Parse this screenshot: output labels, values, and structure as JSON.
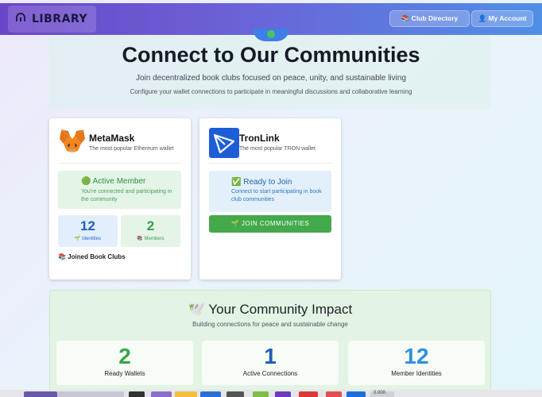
{
  "topbar": {
    "brand": "LIBRARY",
    "nav": [
      {
        "label": "📚 Club Directory"
      },
      {
        "label": "👤 My Account"
      }
    ]
  },
  "hero": {
    "title": "Connect to Our Communities",
    "subtitle": "Join decentralized book clubs focused on peace, unity, and sustainable living",
    "description": "Configure your wallet connections to participate in meaningful discussions and collaborative learning"
  },
  "wallets": {
    "metamask": {
      "name": "MetaMask",
      "desc": "The most popular Ethereum wallet",
      "status_title": "🟢 Active Member",
      "status_desc": "You're connected and participating in the community",
      "identities": "12",
      "identities_label": "🌱 Identities",
      "members": "2",
      "members_label": "📚 Members",
      "joined": "📚 Joined Book Clubs"
    },
    "tronlink": {
      "name": "TronLink",
      "desc": "The most popular TRON wallet",
      "status_title": "✅ Ready to Join",
      "status_desc": "Connect to start participating in book club communities",
      "join_button": "🌱 JOIN COMMUNITIES"
    }
  },
  "impact": {
    "title": "🕊️ Your Community Impact",
    "subtitle": "Building connections for peace and sustainable change",
    "metrics": [
      {
        "value": "2",
        "label": "Ready Wallets"
      },
      {
        "value": "1",
        "label": "Active Connections"
      },
      {
        "value": "12",
        "label": "Member Identities"
      }
    ]
  },
  "dock": {
    "label": "0.000"
  },
  "colors": {
    "primary": "#6b45c7",
    "accent_blue": "#4f8fe6",
    "success": "#43a94b",
    "info": "#1b67b3"
  }
}
